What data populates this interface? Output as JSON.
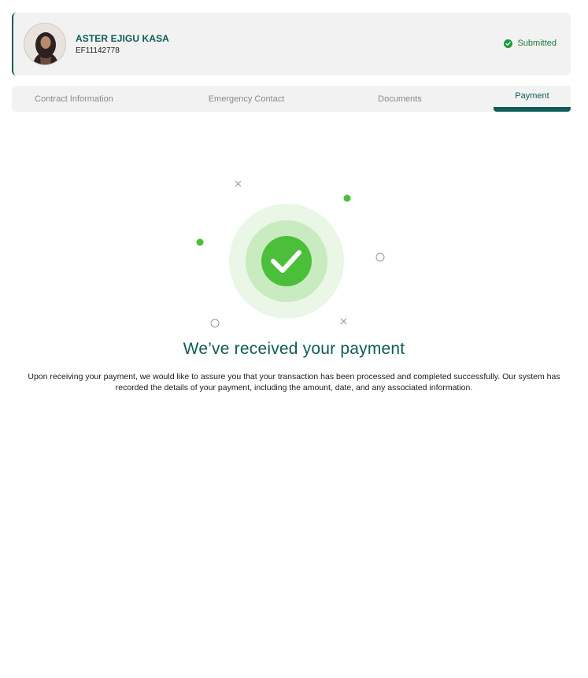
{
  "profile": {
    "name": "ASTER EJIGU KASA",
    "employee_id": "EF11142778",
    "status": "Submitted",
    "status_icon": "check-circle-icon",
    "status_color": "#1e7a3a"
  },
  "tabs": [
    {
      "label": "Contract Information",
      "active": false
    },
    {
      "label": "Emergency Contact",
      "active": false
    },
    {
      "label": "Documents",
      "active": false
    },
    {
      "label": "Payment",
      "active": true
    }
  ],
  "confirmation": {
    "icon": "check-icon",
    "title": "We’ve received your payment",
    "description": "Upon receiving your payment, we would like to assure you that your transaction has been processed and completed successfully. Our system has recorded the details of your payment, including the amount, date, and any associated information."
  },
  "colors": {
    "brand": "#0d5c57",
    "success": "#4cbf3a",
    "panel": "#f2f2f2"
  }
}
